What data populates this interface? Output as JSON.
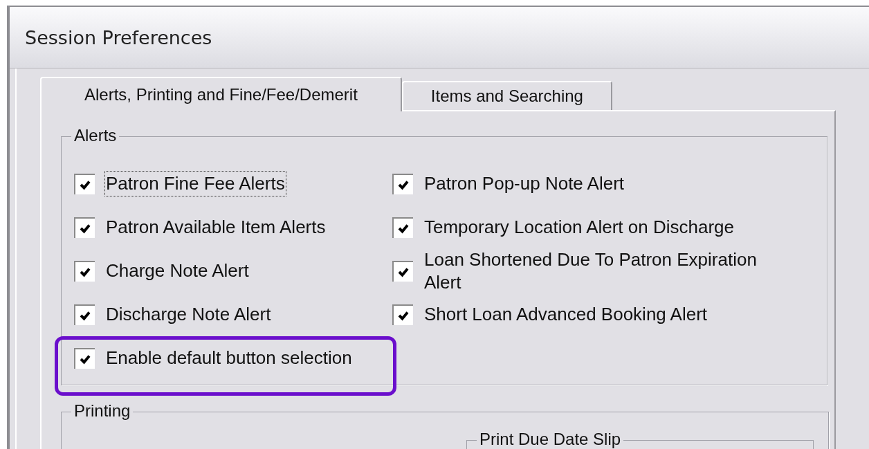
{
  "window": {
    "title": "Session Preferences"
  },
  "tabs": [
    {
      "label": "Alerts, Printing and Fine/Fee/Demerit",
      "selected": true
    },
    {
      "label": "Items and Searching",
      "selected": false
    }
  ],
  "alerts": {
    "title": "Alerts",
    "columns": [
      [
        {
          "label": "Patron Fine Fee Alerts",
          "checked": true,
          "focused": true,
          "highlighted": false
        },
        {
          "label": "Patron Available Item Alerts",
          "checked": true,
          "focused": false,
          "highlighted": false
        },
        {
          "label": "Charge Note Alert",
          "checked": true,
          "focused": false,
          "highlighted": false
        },
        {
          "label": "Discharge Note Alert",
          "checked": true,
          "focused": false,
          "highlighted": false
        },
        {
          "label": "Enable default button selection",
          "checked": true,
          "focused": false,
          "highlighted": true
        }
      ],
      [
        {
          "label": "Patron Pop-up Note Alert",
          "checked": true,
          "focused": false,
          "highlighted": false
        },
        {
          "label": "Temporary Location Alert on Discharge",
          "checked": true,
          "focused": false,
          "highlighted": false
        },
        {
          "label": "Loan Shortened Due To Patron Expiration Alert",
          "checked": true,
          "focused": false,
          "highlighted": false
        },
        {
          "label": "Short Loan Advanced Booking Alert",
          "checked": true,
          "focused": false,
          "highlighted": false
        }
      ]
    ]
  },
  "printing": {
    "title": "Printing",
    "print_due_date_slip": {
      "title": "Print Due Date Slip"
    }
  }
}
